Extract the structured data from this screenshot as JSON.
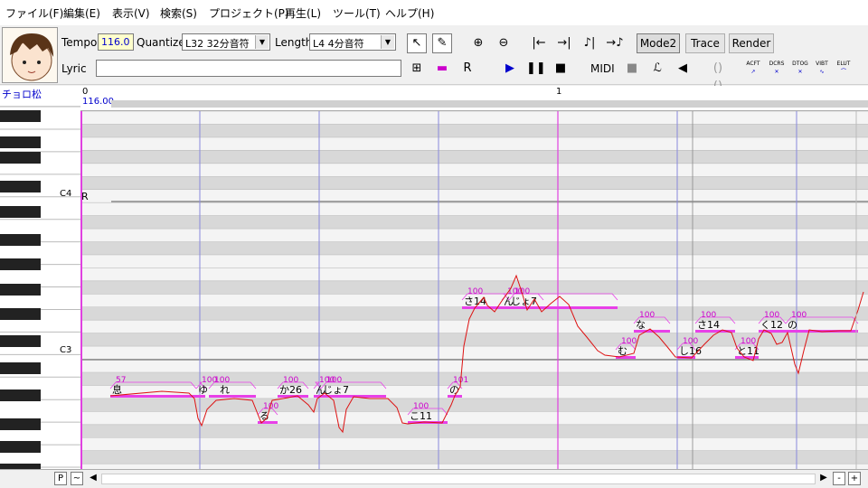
{
  "menu": [
    "ファイル(F)",
    "編集(E)",
    "表示(V)",
    "検索(S)",
    "プロジェクト(P)",
    "再生(L)",
    "ツール(T)",
    "ヘルプ(H)"
  ],
  "toolbar": {
    "tempo_label": "Tempo",
    "tempo_value": "116.0",
    "quantize_label": "Quantize",
    "quantize_value": "L32 32分音符",
    "length_label": "Length",
    "length_value": "L4  4分音符",
    "lyric_label": "Lyric",
    "lyric_value": "",
    "mode_label": "Mode2",
    "trace_label": "Trace",
    "render_label": "Render",
    "midi_label": "MIDI",
    "r_button_label": "R",
    "effect_buttons": [
      "ACFT",
      "DCRS",
      "DTOG",
      "VIBT",
      "ELUT"
    ]
  },
  "track": {
    "name": "チョロ松"
  },
  "ruler": {
    "start_measure": "0",
    "start_tempo": "116.00",
    "measure2": "1"
  },
  "keyboard": {
    "c4_label": "C4",
    "c3_label": "C3"
  },
  "roll": {
    "rest_label": "R",
    "notes": [
      {
        "lyric": "息",
        "vel": "57"
      },
      {
        "lyric": "ゆ",
        "vel": "100"
      },
      {
        "lyric": "れ",
        "vel": "100"
      },
      {
        "lyric": "る",
        "vel": "100"
      },
      {
        "lyric": "か26",
        "vel": "100"
      },
      {
        "lyric": "ん",
        "vel": "100"
      },
      {
        "lyric": "じょ7",
        "vel": "100"
      },
      {
        "lyric": "こ11",
        "vel": "100"
      },
      {
        "lyric": "の",
        "vel": "101"
      },
      {
        "lyric": "さ14",
        "vel": "100"
      },
      {
        "lyric": "ん",
        "vel": "100"
      },
      {
        "lyric": "じょ7",
        "vel": "100"
      },
      {
        "lyric": "む",
        "vel": "100"
      },
      {
        "lyric": "な",
        "vel": "100"
      },
      {
        "lyric": "し16",
        "vel": "100"
      },
      {
        "lyric": "さ14",
        "vel": "100"
      },
      {
        "lyric": "と11",
        "vel": "100"
      },
      {
        "lyric": "く12",
        "vel": "100"
      },
      {
        "lyric": "の",
        "vel": "100"
      }
    ]
  },
  "bottombar": {
    "p_label": "P",
    "tilde_label": "~",
    "minus_label": "-",
    "plus_label": "+"
  },
  "colors": {
    "note_bar": "#e840e8",
    "pitch_line": "#dd1111",
    "grid_line_measure": "#e040e0",
    "grid_line_beat": "#8888dd"
  }
}
